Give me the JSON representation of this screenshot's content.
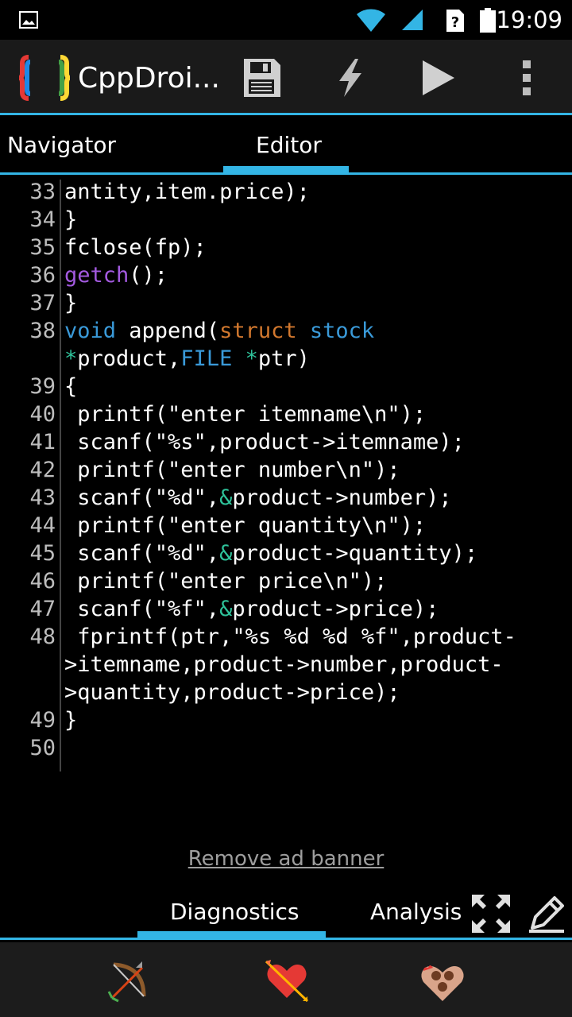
{
  "status_bar": {
    "time": "19:09",
    "icons": [
      "image-icon",
      "wifi-icon",
      "signal-icon",
      "sim-unknown-icon",
      "battery-icon"
    ]
  },
  "action_bar": {
    "title": "CppDroi...",
    "buttons": [
      "save-icon",
      "flash-icon",
      "run-icon",
      "overflow-menu-icon"
    ]
  },
  "tabs": {
    "navigator": "Navigator",
    "editor": "Editor",
    "active": "Editor"
  },
  "editor": {
    "lines": [
      {
        "num": "33",
        "segments": [
          {
            "t": "antity,item.price);",
            "c": ""
          }
        ]
      },
      {
        "num": "34",
        "segments": [
          {
            "t": "}",
            "c": ""
          }
        ]
      },
      {
        "num": "35",
        "segments": [
          {
            "t": "fclose(fp);",
            "c": ""
          }
        ]
      },
      {
        "num": "36",
        "segments": [
          {
            "t": "getch",
            "c": "kw-purple"
          },
          {
            "t": "();",
            "c": ""
          }
        ]
      },
      {
        "num": "37",
        "segments": [
          {
            "t": "}",
            "c": ""
          }
        ]
      },
      {
        "num": "38",
        "segments": [
          {
            "t": "void",
            "c": "kw-blue"
          },
          {
            "t": " append(",
            "c": ""
          },
          {
            "t": "struct",
            "c": "kw-orange"
          },
          {
            "t": " ",
            "c": ""
          },
          {
            "t": "stock",
            "c": "kw-blue"
          }
        ]
      },
      {
        "num": "",
        "segments": [
          {
            "t": "*",
            "c": "kw-green"
          },
          {
            "t": "product,",
            "c": ""
          },
          {
            "t": "FILE",
            "c": "kw-blue"
          },
          {
            "t": " ",
            "c": ""
          },
          {
            "t": "*",
            "c": "kw-green"
          },
          {
            "t": "ptr)",
            "c": ""
          }
        ]
      },
      {
        "num": "39",
        "segments": [
          {
            "t": "{",
            "c": ""
          }
        ]
      },
      {
        "num": "40",
        "segments": [
          {
            "t": " printf(\"enter itemname\\n\");",
            "c": ""
          }
        ]
      },
      {
        "num": "41",
        "segments": [
          {
            "t": " scanf(\"%s\",product->itemname);",
            "c": ""
          }
        ]
      },
      {
        "num": "42",
        "segments": [
          {
            "t": " printf(\"enter number\\n\");",
            "c": ""
          }
        ]
      },
      {
        "num": "43",
        "segments": [
          {
            "t": " scanf(\"%d\",",
            "c": ""
          },
          {
            "t": "&",
            "c": "kw-green"
          },
          {
            "t": "product->number);",
            "c": ""
          }
        ]
      },
      {
        "num": "44",
        "segments": [
          {
            "t": " printf(\"enter quantity\\n\");",
            "c": ""
          }
        ]
      },
      {
        "num": "45",
        "segments": [
          {
            "t": " scanf(\"%d\",",
            "c": ""
          },
          {
            "t": "&",
            "c": "kw-green"
          },
          {
            "t": "product->quantity);",
            "c": ""
          }
        ]
      },
      {
        "num": "46",
        "segments": [
          {
            "t": " printf(\"enter price\\n\");",
            "c": ""
          }
        ]
      },
      {
        "num": "47",
        "segments": [
          {
            "t": " scanf(\"%f\",",
            "c": ""
          },
          {
            "t": "&",
            "c": "kw-green"
          },
          {
            "t": "product->price);",
            "c": ""
          }
        ]
      },
      {
        "num": "48",
        "segments": [
          {
            "t": " fprintf(ptr,\"%s %d %d %f\",product-",
            "c": ""
          }
        ]
      },
      {
        "num": "",
        "segments": [
          {
            "t": ">itemname,product->number,product-",
            "c": ""
          }
        ]
      },
      {
        "num": "",
        "segments": [
          {
            "t": ">quantity,product->price);",
            "c": ""
          }
        ]
      },
      {
        "num": "49",
        "segments": [
          {
            "t": "}",
            "c": ""
          }
        ]
      },
      {
        "num": "50",
        "segments": []
      }
    ]
  },
  "ad": {
    "remove_label": "Remove ad banner"
  },
  "bottom_tabs": {
    "diagnostics": "Diagnostics",
    "analysis": "Analysis",
    "active": "Diagnostics"
  },
  "emoji_bar": {
    "items": [
      "bow-and-arrow-icon",
      "heart-with-arrow-icon",
      "love-chocolates-icon"
    ]
  },
  "colors": {
    "accent": "#33b5e5",
    "keyword": "#3a9ad9",
    "function": "#a35ae0",
    "type": "#d2782e",
    "operator": "#2ec29a"
  }
}
